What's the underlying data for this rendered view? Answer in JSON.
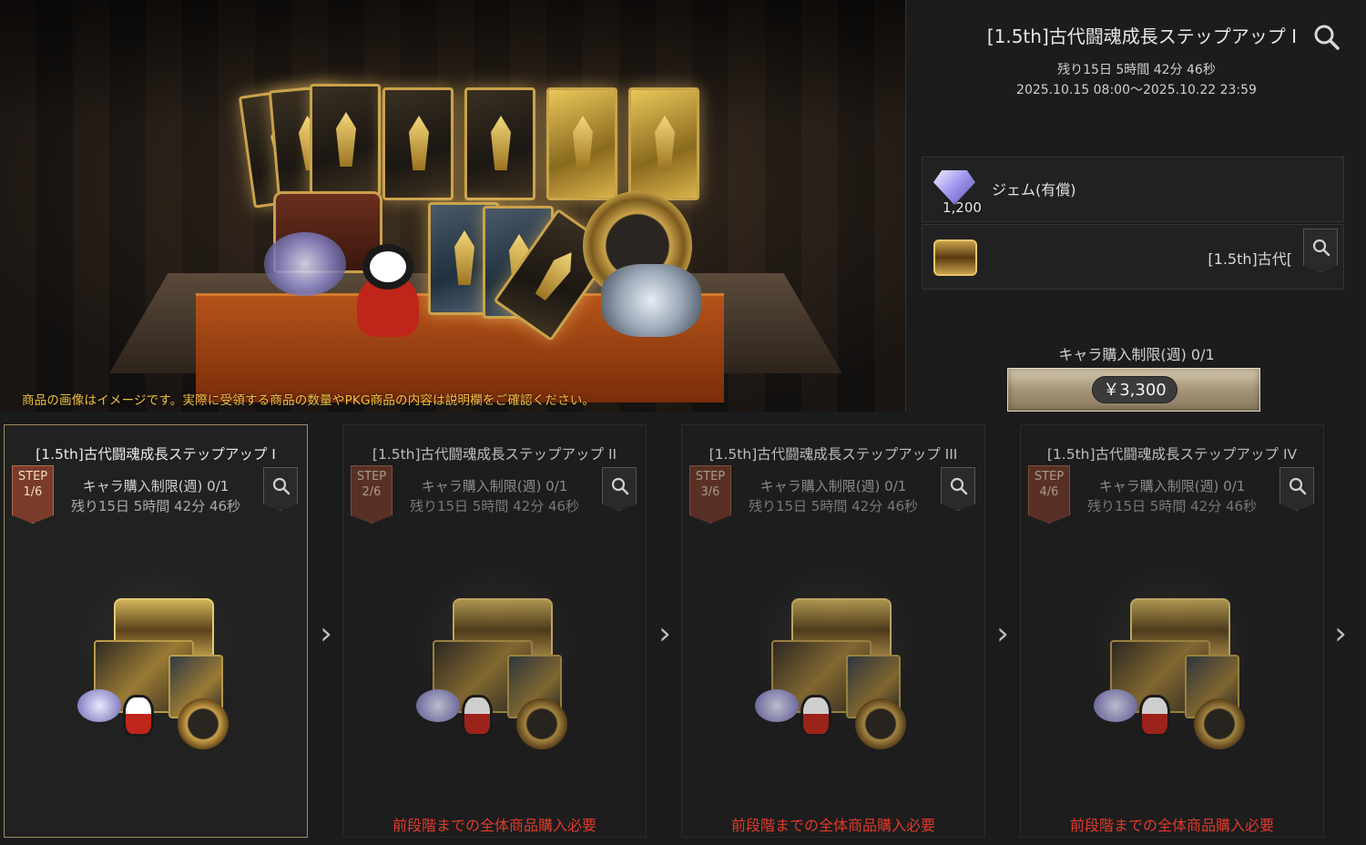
{
  "banner": {
    "note": "商品の画像はイメージです。実際に受領する商品の数量やPKG商品の内容は説明欄をご確認ください。"
  },
  "detail": {
    "title": "[1.5th]古代闘魂成長ステップアップ I",
    "remaining": "残り15日 5時間 42分 46秒",
    "period": "2025.10.15 08:00～2025.10.22 23:59",
    "search_icon": "search-icon",
    "rewards": [
      {
        "icon": "gem-icon",
        "name": "ジェム(有償)",
        "quantity": "1,200"
      },
      {
        "icon": "treasure-chest-icon",
        "name": "[1.5th]古代["
      }
    ],
    "limit": "キャラ購入制限(週) 0/1",
    "price": "￥3,300"
  },
  "steps": [
    {
      "title": "[1.5th]古代闘魂成長ステップアップ I",
      "ribbon_top": "STEP",
      "ribbon_bottom": "1/6",
      "limit": "キャラ購入制限(週) 0/1",
      "remaining": "残り15日 5時間 42分 46秒",
      "warning": ""
    },
    {
      "title": "[1.5th]古代闘魂成長ステップアップ II",
      "ribbon_top": "STEP",
      "ribbon_bottom": "2/6",
      "limit": "キャラ購入制限(週) 0/1",
      "remaining": "残り15日 5時間 42分 46秒",
      "warning": "前段階までの全体商品購入必要"
    },
    {
      "title": "[1.5th]古代闘魂成長ステップアップ III",
      "ribbon_top": "STEP",
      "ribbon_bottom": "3/6",
      "limit": "キャラ購入制限(週) 0/1",
      "remaining": "残り15日 5時間 42分 46秒",
      "warning": "前段階までの全体商品購入必要"
    },
    {
      "title": "[1.5th]古代闘魂成長ステップアップ IV",
      "ribbon_top": "STEP",
      "ribbon_bottom": "4/6",
      "limit": "キャラ購入制限(週) 0/1",
      "remaining": "残り15日 5時間 42分 46秒",
      "warning": "前段階までの全体商品購入必要"
    }
  ],
  "arrows": [
    "›",
    "›",
    "›",
    "›"
  ],
  "colors": {
    "warning": "#e03a2a",
    "note": "#f0c242",
    "accent_gold": "#c9a24a",
    "ribbon": "#7a3b2a"
  }
}
